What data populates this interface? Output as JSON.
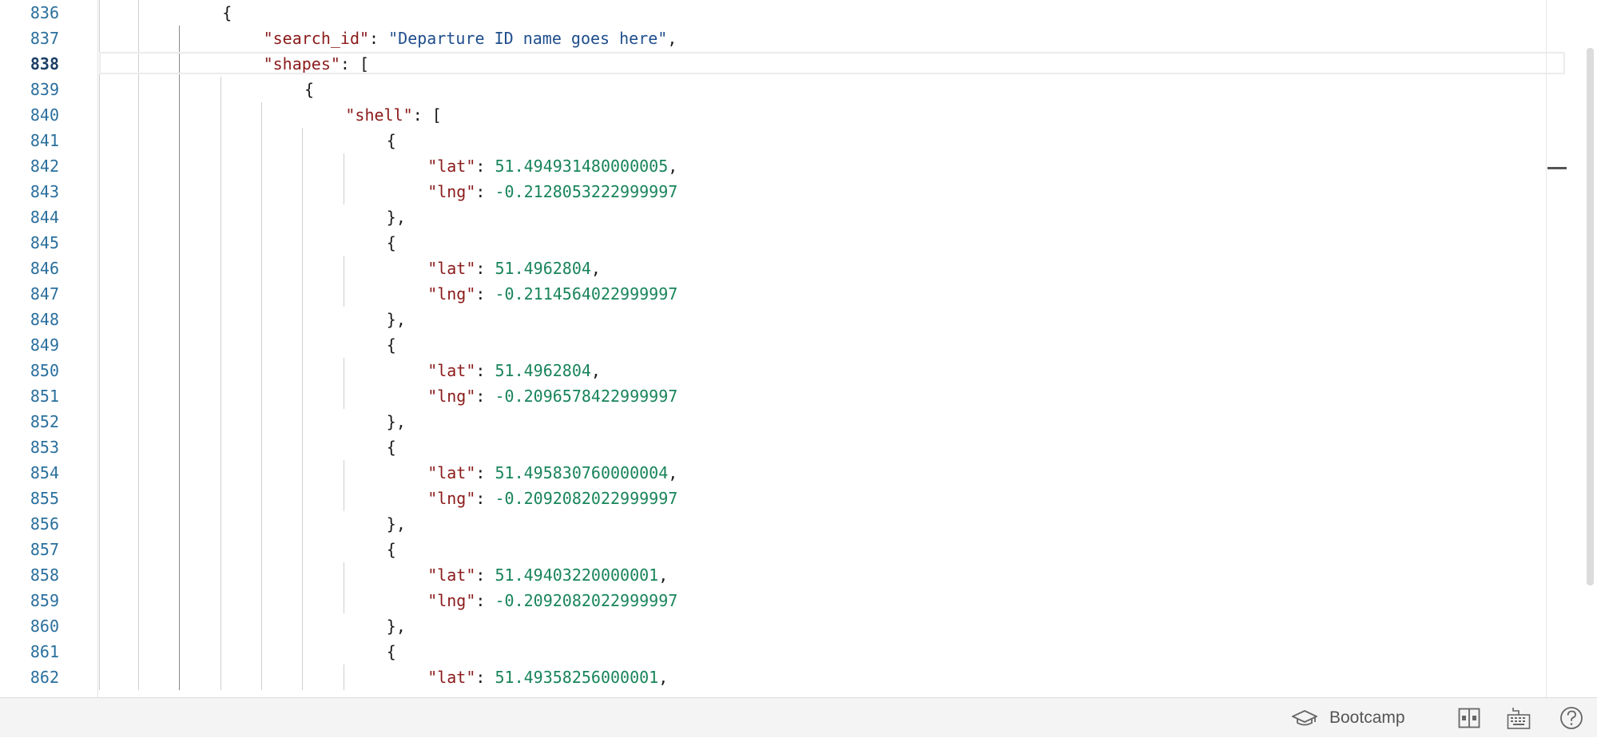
{
  "editor": {
    "current_line": 838,
    "lines": [
      {
        "num": "836",
        "indent": 4,
        "tokens": [
          {
            "t": "p",
            "v": "{"
          }
        ]
      },
      {
        "num": "837",
        "indent": 5,
        "tokens": [
          {
            "t": "k",
            "v": "\"search_id\""
          },
          {
            "t": "p",
            "v": ": "
          },
          {
            "t": "s",
            "v": "\"Departure ID name goes here\""
          },
          {
            "t": "p",
            "v": ","
          }
        ]
      },
      {
        "num": "838",
        "indent": 5,
        "tokens": [
          {
            "t": "k",
            "v": "\"shapes\""
          },
          {
            "t": "p",
            "v": ": ["
          }
        ]
      },
      {
        "num": "839",
        "indent": 6,
        "tokens": [
          {
            "t": "p",
            "v": "{"
          }
        ]
      },
      {
        "num": "840",
        "indent": 7,
        "tokens": [
          {
            "t": "k",
            "v": "\"shell\""
          },
          {
            "t": "p",
            "v": ": ["
          }
        ]
      },
      {
        "num": "841",
        "indent": 8,
        "tokens": [
          {
            "t": "p",
            "v": "{"
          }
        ]
      },
      {
        "num": "842",
        "indent": 9,
        "tokens": [
          {
            "t": "k",
            "v": "\"lat\""
          },
          {
            "t": "p",
            "v": ": "
          },
          {
            "t": "n",
            "v": "51.494931480000005"
          },
          {
            "t": "p",
            "v": ","
          }
        ]
      },
      {
        "num": "843",
        "indent": 9,
        "tokens": [
          {
            "t": "k",
            "v": "\"lng\""
          },
          {
            "t": "p",
            "v": ": "
          },
          {
            "t": "n",
            "v": "-0.2128053222999997"
          }
        ]
      },
      {
        "num": "844",
        "indent": 8,
        "tokens": [
          {
            "t": "p",
            "v": "},"
          }
        ]
      },
      {
        "num": "845",
        "indent": 8,
        "tokens": [
          {
            "t": "p",
            "v": "{"
          }
        ]
      },
      {
        "num": "846",
        "indent": 9,
        "tokens": [
          {
            "t": "k",
            "v": "\"lat\""
          },
          {
            "t": "p",
            "v": ": "
          },
          {
            "t": "n",
            "v": "51.4962804"
          },
          {
            "t": "p",
            "v": ","
          }
        ]
      },
      {
        "num": "847",
        "indent": 9,
        "tokens": [
          {
            "t": "k",
            "v": "\"lng\""
          },
          {
            "t": "p",
            "v": ": "
          },
          {
            "t": "n",
            "v": "-0.2114564022999997"
          }
        ]
      },
      {
        "num": "848",
        "indent": 8,
        "tokens": [
          {
            "t": "p",
            "v": "},"
          }
        ]
      },
      {
        "num": "849",
        "indent": 8,
        "tokens": [
          {
            "t": "p",
            "v": "{"
          }
        ]
      },
      {
        "num": "850",
        "indent": 9,
        "tokens": [
          {
            "t": "k",
            "v": "\"lat\""
          },
          {
            "t": "p",
            "v": ": "
          },
          {
            "t": "n",
            "v": "51.4962804"
          },
          {
            "t": "p",
            "v": ","
          }
        ]
      },
      {
        "num": "851",
        "indent": 9,
        "tokens": [
          {
            "t": "k",
            "v": "\"lng\""
          },
          {
            "t": "p",
            "v": ": "
          },
          {
            "t": "n",
            "v": "-0.2096578422999997"
          }
        ]
      },
      {
        "num": "852",
        "indent": 8,
        "tokens": [
          {
            "t": "p",
            "v": "},"
          }
        ]
      },
      {
        "num": "853",
        "indent": 8,
        "tokens": [
          {
            "t": "p",
            "v": "{"
          }
        ]
      },
      {
        "num": "854",
        "indent": 9,
        "tokens": [
          {
            "t": "k",
            "v": "\"lat\""
          },
          {
            "t": "p",
            "v": ": "
          },
          {
            "t": "n",
            "v": "51.495830760000004"
          },
          {
            "t": "p",
            "v": ","
          }
        ]
      },
      {
        "num": "855",
        "indent": 9,
        "tokens": [
          {
            "t": "k",
            "v": "\"lng\""
          },
          {
            "t": "p",
            "v": ": "
          },
          {
            "t": "n",
            "v": "-0.2092082022999997"
          }
        ]
      },
      {
        "num": "856",
        "indent": 8,
        "tokens": [
          {
            "t": "p",
            "v": "},"
          }
        ]
      },
      {
        "num": "857",
        "indent": 8,
        "tokens": [
          {
            "t": "p",
            "v": "{"
          }
        ]
      },
      {
        "num": "858",
        "indent": 9,
        "tokens": [
          {
            "t": "k",
            "v": "\"lat\""
          },
          {
            "t": "p",
            "v": ": "
          },
          {
            "t": "n",
            "v": "51.49403220000001"
          },
          {
            "t": "p",
            "v": ","
          }
        ]
      },
      {
        "num": "859",
        "indent": 9,
        "tokens": [
          {
            "t": "k",
            "v": "\"lng\""
          },
          {
            "t": "p",
            "v": ": "
          },
          {
            "t": "n",
            "v": "-0.2092082022999997"
          }
        ]
      },
      {
        "num": "860",
        "indent": 8,
        "tokens": [
          {
            "t": "p",
            "v": "},"
          }
        ]
      },
      {
        "num": "861",
        "indent": 8,
        "tokens": [
          {
            "t": "p",
            "v": "{"
          }
        ]
      },
      {
        "num": "862",
        "indent": 9,
        "tokens": [
          {
            "t": "k",
            "v": "\"lat\""
          },
          {
            "t": "p",
            "v": ": "
          },
          {
            "t": "n",
            "v": "51.49358256000001"
          },
          {
            "t": "p",
            "v": ","
          }
        ]
      }
    ]
  },
  "statusbar": {
    "bootcamp_label": "Bootcamp",
    "icons": [
      "graduation-cap-icon",
      "split-view-icon",
      "keyboard-icon",
      "help-icon"
    ]
  },
  "colors": {
    "key": "#8b1a1a",
    "string": "#1f4e8c",
    "number": "#18845a",
    "line_number": "#2a6f9d"
  }
}
